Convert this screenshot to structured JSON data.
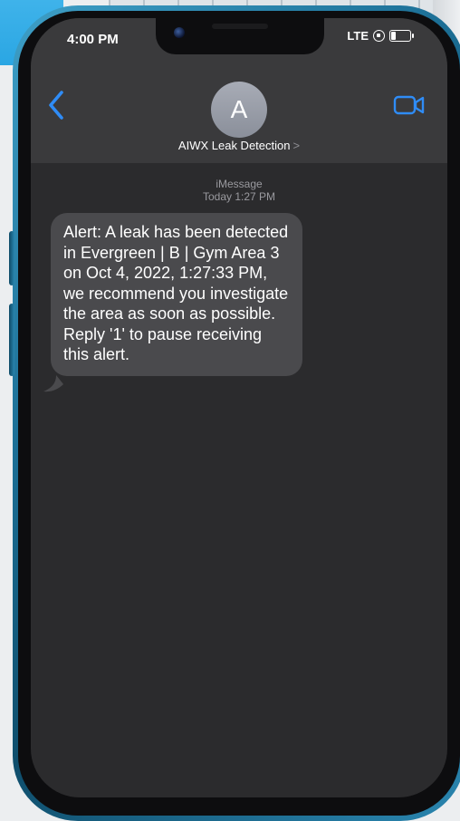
{
  "status_bar": {
    "time": "4:00 PM",
    "network": "LTE"
  },
  "header": {
    "avatar_initial": "A",
    "contact_name": "AIWX Leak Detection",
    "contact_chevron": ">"
  },
  "thread": {
    "service": "iMessage",
    "timestamp": "Today 1:27 PM"
  },
  "messages": [
    {
      "direction": "incoming",
      "text": "Alert: A leak has been detected in Evergreen | B | Gym Area 3 on Oct 4, 2022, 1:27:33 PM, we recommend you investigate the area as soon as possible. Reply '1' to pause receiving this alert."
    }
  ],
  "colors": {
    "accent": "#2f8cf6",
    "bubble_incoming": "#4a4a4d",
    "screen_bg": "#2b2b2d",
    "header_bg": "#3a3a3c"
  },
  "icons": [
    "back-chevron-icon",
    "video-camera-icon",
    "lock-rotation-icon",
    "battery-icon"
  ]
}
